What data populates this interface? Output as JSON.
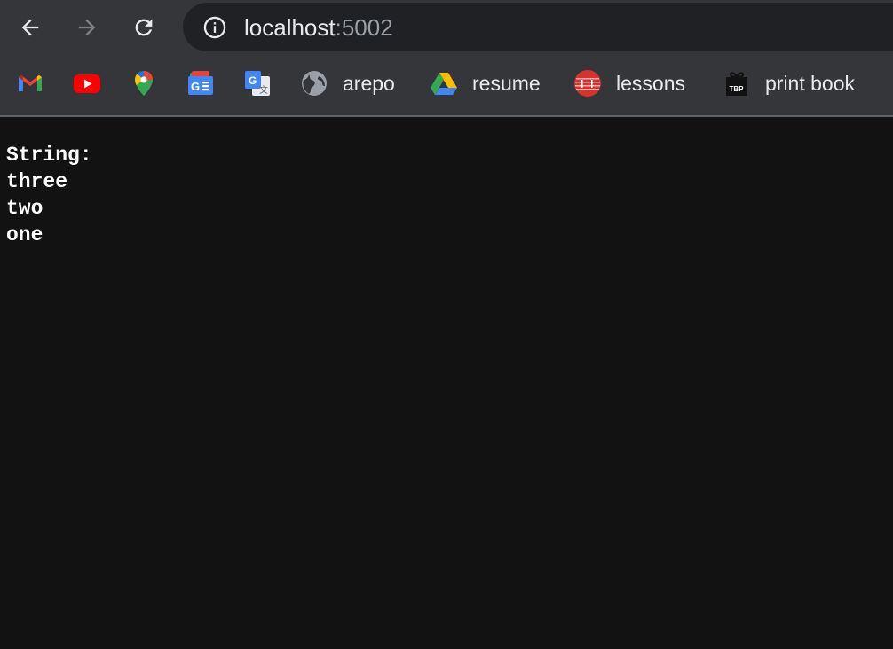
{
  "browser": {
    "url_host": "localhost",
    "url_port": ":5002"
  },
  "bookmarks": [
    {
      "icon": "gmail-icon",
      "label": ""
    },
    {
      "icon": "youtube-icon",
      "label": ""
    },
    {
      "icon": "google-maps-icon",
      "label": ""
    },
    {
      "icon": "google-news-icon",
      "label": ""
    },
    {
      "icon": "google-translate-icon",
      "label": ""
    },
    {
      "icon": "globe-icon",
      "label": "arepo"
    },
    {
      "icon": "google-drive-icon",
      "label": "resume"
    },
    {
      "icon": "lessons-icon",
      "label": "lessons"
    },
    {
      "icon": "tbp-gift-icon",
      "label": "print book"
    }
  ],
  "page": {
    "lines": [
      "String:",
      "three",
      "two",
      "one"
    ]
  },
  "colors": {
    "toolbar_bg": "#35363a",
    "omnibox_bg": "#202124",
    "page_bg": "#121212",
    "text": "#ffffff"
  }
}
